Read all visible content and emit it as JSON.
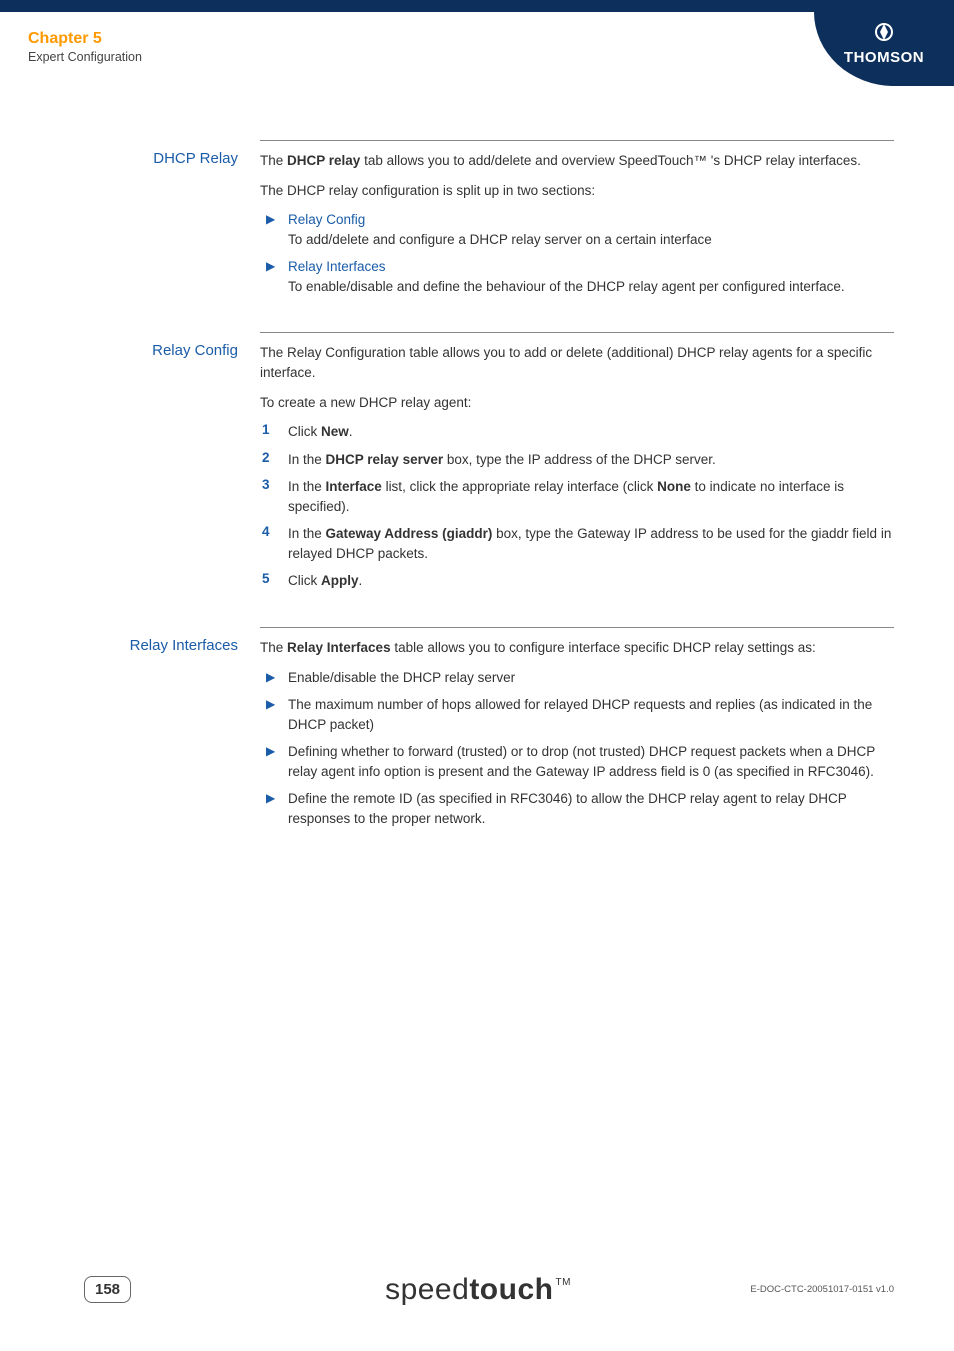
{
  "header": {
    "chapter": "Chapter 5",
    "subtitle": "Expert Configuration",
    "brand": "THOMSON"
  },
  "sections": {
    "dhcp_relay": {
      "label": "DHCP Relay",
      "intro_pre": "The ",
      "intro_bold": "DHCP relay",
      "intro_post": " tab allows you to add/delete and overview SpeedTouch™ 's DHCP relay interfaces.",
      "split": "The DHCP relay configuration is split up in two sections:",
      "b1_title": "Relay Config",
      "b1_desc": "To add/delete and configure a DHCP relay server on a certain interface",
      "b2_title": "Relay Interfaces",
      "b2_desc": "To enable/disable and define the behaviour of the DHCP relay agent per configured interface."
    },
    "relay_config": {
      "label": "Relay Config",
      "intro": "The Relay Configuration table allows you to add or delete (additional) DHCP relay agents for a specific interface.",
      "create": "To create a new DHCP relay agent:",
      "s1_pre": "Click ",
      "s1_bold": "New",
      "s1_post": ".",
      "s2_pre": "In the ",
      "s2_bold": "DHCP relay server",
      "s2_post": " box, type the IP address of the DHCP server.",
      "s3_pre": "In the ",
      "s3_bold1": "Interface",
      "s3_mid": " list, click the appropriate relay interface (click ",
      "s3_bold2": "None",
      "s3_post": " to indicate no interface is specified).",
      "s4_pre": "In the ",
      "s4_bold": "Gateway Address (giaddr)",
      "s4_post": " box, type the Gateway IP address to be used for the giaddr field in relayed DHCP packets.",
      "s5_pre": "Click ",
      "s5_bold": "Apply",
      "s5_post": "."
    },
    "relay_interfaces": {
      "label": "Relay Interfaces",
      "intro_pre": "The ",
      "intro_bold": "Relay Interfaces",
      "intro_post": " table allows you to configure interface specific DHCP relay settings as:",
      "b1": "Enable/disable the DHCP relay server",
      "b2": "The maximum number of hops allowed for relayed DHCP requests and replies (as indicated in the DHCP packet)",
      "b3": "Defining whether to forward (trusted) or to drop (not trusted) DHCP request packets when a DHCP relay agent info option is present and the Gateway IP address field is 0 (as specified in RFC3046).",
      "b4": "Define the remote ID (as specified in RFC3046) to allow the DHCP relay agent to relay DHCP responses to the proper network."
    }
  },
  "footer": {
    "page": "158",
    "logo_light": "speed",
    "logo_bold": "touch",
    "doc_code": "E-DOC-CTC-20051017-0151 v1.0"
  }
}
